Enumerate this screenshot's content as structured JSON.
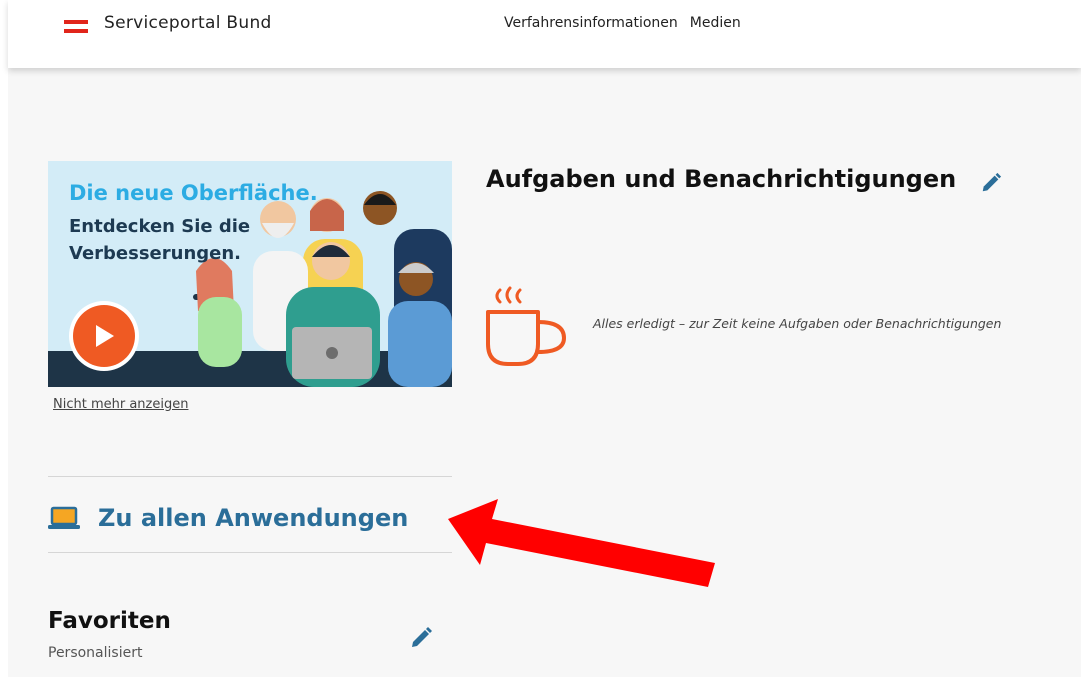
{
  "header": {
    "brand": "Serviceportal Bund",
    "nav": [
      "Verfahrensinformationen",
      "Medien"
    ],
    "brand_colors": {
      "red": "#e1251b",
      "white": "#ffffff"
    }
  },
  "banner": {
    "title": "Die neue Oberfläche.",
    "subtitle_line1": "Entdecken Sie die",
    "subtitle_line2": "Verbesserungen.",
    "play_icon": "play-icon",
    "dismiss_link": "Nicht mehr anzeigen"
  },
  "apps": {
    "label": "Zu allen Anwendungen",
    "icon": "laptop-icon",
    "color": "#2b6e99"
  },
  "favorites": {
    "title": "Favoriten",
    "subtitle": "Personalisiert",
    "edit_icon": "pencil-icon"
  },
  "tasks": {
    "title": "Aufgaben und Benachrichtigungen",
    "edit_icon": "pencil-icon",
    "empty_icon": "coffee-cup-icon",
    "empty_message": "Alles erledigt – zur Zeit keine Aufgaben oder Benachrichtigungen"
  },
  "annotation": {
    "arrow_color": "#ff0000",
    "arrow_icon": "red-arrow-annotation"
  }
}
